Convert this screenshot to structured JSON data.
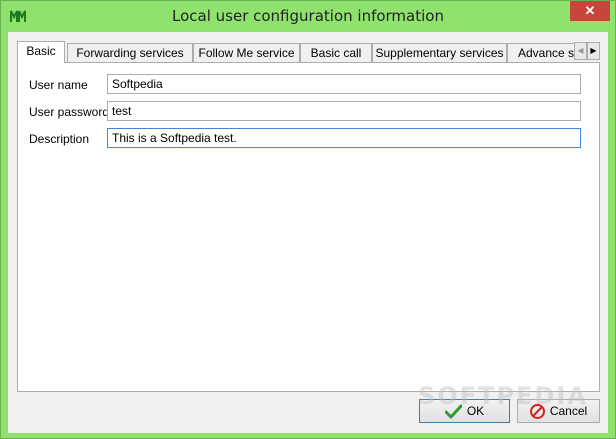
{
  "window": {
    "title": "Local user configuration information",
    "close_glyph": "✕",
    "accent_color": "#90e26e"
  },
  "tabs": [
    {
      "label": "Basic",
      "active": true
    },
    {
      "label": "Forwarding services",
      "active": false
    },
    {
      "label": "Follow Me service",
      "active": false
    },
    {
      "label": "Basic call",
      "active": false
    },
    {
      "label": "Supplementary services",
      "active": false
    },
    {
      "label": "Advance ser",
      "active": false
    }
  ],
  "tab_scroll": {
    "left_glyph": "◀",
    "right_glyph": "▶"
  },
  "form": {
    "user_name": {
      "label": "User name",
      "value": "Softpedia"
    },
    "user_password": {
      "label": "User password",
      "value": "test"
    },
    "description": {
      "label": "Description",
      "value": "This is a Softpedia test."
    }
  },
  "buttons": {
    "ok_label": "OK",
    "cancel_label": "Cancel"
  },
  "icons": {
    "app": "app-logo-icon",
    "ok": "checkmark-icon",
    "cancel": "no-entry-icon"
  },
  "watermark": "SOFTPEDIA"
}
